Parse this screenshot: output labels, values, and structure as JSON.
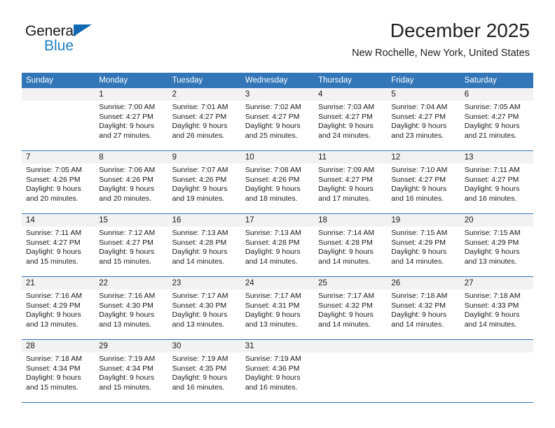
{
  "brand": {
    "name_top": "General",
    "name_bottom": "Blue",
    "triangle_color": "#1268b3",
    "blue_color": "#1f7fc4"
  },
  "header": {
    "title": "December 2025",
    "subtitle": "New Rochelle, New York, United States"
  },
  "theme": {
    "header_row_bg": "#3276b8",
    "header_row_text": "#ffffff",
    "daynum_band_bg": "#f2f2f2",
    "cell_bg": "#ffffff",
    "separator": "#3276b8"
  },
  "weekdays": [
    "Sunday",
    "Monday",
    "Tuesday",
    "Wednesday",
    "Thursday",
    "Friday",
    "Saturday"
  ],
  "weeks": [
    {
      "days": [
        {
          "num": "",
          "lines": []
        },
        {
          "num": "1",
          "lines": [
            "Sunrise: 7:00 AM",
            "Sunset: 4:27 PM",
            "Daylight: 9 hours",
            "and 27 minutes."
          ]
        },
        {
          "num": "2",
          "lines": [
            "Sunrise: 7:01 AM",
            "Sunset: 4:27 PM",
            "Daylight: 9 hours",
            "and 26 minutes."
          ]
        },
        {
          "num": "3",
          "lines": [
            "Sunrise: 7:02 AM",
            "Sunset: 4:27 PM",
            "Daylight: 9 hours",
            "and 25 minutes."
          ]
        },
        {
          "num": "4",
          "lines": [
            "Sunrise: 7:03 AM",
            "Sunset: 4:27 PM",
            "Daylight: 9 hours",
            "and 24 minutes."
          ]
        },
        {
          "num": "5",
          "lines": [
            "Sunrise: 7:04 AM",
            "Sunset: 4:27 PM",
            "Daylight: 9 hours",
            "and 23 minutes."
          ]
        },
        {
          "num": "6",
          "lines": [
            "Sunrise: 7:05 AM",
            "Sunset: 4:27 PM",
            "Daylight: 9 hours",
            "and 21 minutes."
          ]
        }
      ]
    },
    {
      "days": [
        {
          "num": "7",
          "lines": [
            "Sunrise: 7:05 AM",
            "Sunset: 4:26 PM",
            "Daylight: 9 hours",
            "and 20 minutes."
          ]
        },
        {
          "num": "8",
          "lines": [
            "Sunrise: 7:06 AM",
            "Sunset: 4:26 PM",
            "Daylight: 9 hours",
            "and 20 minutes."
          ]
        },
        {
          "num": "9",
          "lines": [
            "Sunrise: 7:07 AM",
            "Sunset: 4:26 PM",
            "Daylight: 9 hours",
            "and 19 minutes."
          ]
        },
        {
          "num": "10",
          "lines": [
            "Sunrise: 7:08 AM",
            "Sunset: 4:26 PM",
            "Daylight: 9 hours",
            "and 18 minutes."
          ]
        },
        {
          "num": "11",
          "lines": [
            "Sunrise: 7:09 AM",
            "Sunset: 4:27 PM",
            "Daylight: 9 hours",
            "and 17 minutes."
          ]
        },
        {
          "num": "12",
          "lines": [
            "Sunrise: 7:10 AM",
            "Sunset: 4:27 PM",
            "Daylight: 9 hours",
            "and 16 minutes."
          ]
        },
        {
          "num": "13",
          "lines": [
            "Sunrise: 7:11 AM",
            "Sunset: 4:27 PM",
            "Daylight: 9 hours",
            "and 16 minutes."
          ]
        }
      ]
    },
    {
      "days": [
        {
          "num": "14",
          "lines": [
            "Sunrise: 7:11 AM",
            "Sunset: 4:27 PM",
            "Daylight: 9 hours",
            "and 15 minutes."
          ]
        },
        {
          "num": "15",
          "lines": [
            "Sunrise: 7:12 AM",
            "Sunset: 4:27 PM",
            "Daylight: 9 hours",
            "and 15 minutes."
          ]
        },
        {
          "num": "16",
          "lines": [
            "Sunrise: 7:13 AM",
            "Sunset: 4:28 PM",
            "Daylight: 9 hours",
            "and 14 minutes."
          ]
        },
        {
          "num": "17",
          "lines": [
            "Sunrise: 7:13 AM",
            "Sunset: 4:28 PM",
            "Daylight: 9 hours",
            "and 14 minutes."
          ]
        },
        {
          "num": "18",
          "lines": [
            "Sunrise: 7:14 AM",
            "Sunset: 4:28 PM",
            "Daylight: 9 hours",
            "and 14 minutes."
          ]
        },
        {
          "num": "19",
          "lines": [
            "Sunrise: 7:15 AM",
            "Sunset: 4:29 PM",
            "Daylight: 9 hours",
            "and 14 minutes."
          ]
        },
        {
          "num": "20",
          "lines": [
            "Sunrise: 7:15 AM",
            "Sunset: 4:29 PM",
            "Daylight: 9 hours",
            "and 13 minutes."
          ]
        }
      ]
    },
    {
      "days": [
        {
          "num": "21",
          "lines": [
            "Sunrise: 7:16 AM",
            "Sunset: 4:29 PM",
            "Daylight: 9 hours",
            "and 13 minutes."
          ]
        },
        {
          "num": "22",
          "lines": [
            "Sunrise: 7:16 AM",
            "Sunset: 4:30 PM",
            "Daylight: 9 hours",
            "and 13 minutes."
          ]
        },
        {
          "num": "23",
          "lines": [
            "Sunrise: 7:17 AM",
            "Sunset: 4:30 PM",
            "Daylight: 9 hours",
            "and 13 minutes."
          ]
        },
        {
          "num": "24",
          "lines": [
            "Sunrise: 7:17 AM",
            "Sunset: 4:31 PM",
            "Daylight: 9 hours",
            "and 13 minutes."
          ]
        },
        {
          "num": "25",
          "lines": [
            "Sunrise: 7:17 AM",
            "Sunset: 4:32 PM",
            "Daylight: 9 hours",
            "and 14 minutes."
          ]
        },
        {
          "num": "26",
          "lines": [
            "Sunrise: 7:18 AM",
            "Sunset: 4:32 PM",
            "Daylight: 9 hours",
            "and 14 minutes."
          ]
        },
        {
          "num": "27",
          "lines": [
            "Sunrise: 7:18 AM",
            "Sunset: 4:33 PM",
            "Daylight: 9 hours",
            "and 14 minutes."
          ]
        }
      ]
    },
    {
      "days": [
        {
          "num": "28",
          "lines": [
            "Sunrise: 7:18 AM",
            "Sunset: 4:34 PM",
            "Daylight: 9 hours",
            "and 15 minutes."
          ]
        },
        {
          "num": "29",
          "lines": [
            "Sunrise: 7:19 AM",
            "Sunset: 4:34 PM",
            "Daylight: 9 hours",
            "and 15 minutes."
          ]
        },
        {
          "num": "30",
          "lines": [
            "Sunrise: 7:19 AM",
            "Sunset: 4:35 PM",
            "Daylight: 9 hours",
            "and 16 minutes."
          ]
        },
        {
          "num": "31",
          "lines": [
            "Sunrise: 7:19 AM",
            "Sunset: 4:36 PM",
            "Daylight: 9 hours",
            "and 16 minutes."
          ]
        },
        {
          "num": "",
          "lines": []
        },
        {
          "num": "",
          "lines": []
        },
        {
          "num": "",
          "lines": []
        }
      ]
    }
  ]
}
